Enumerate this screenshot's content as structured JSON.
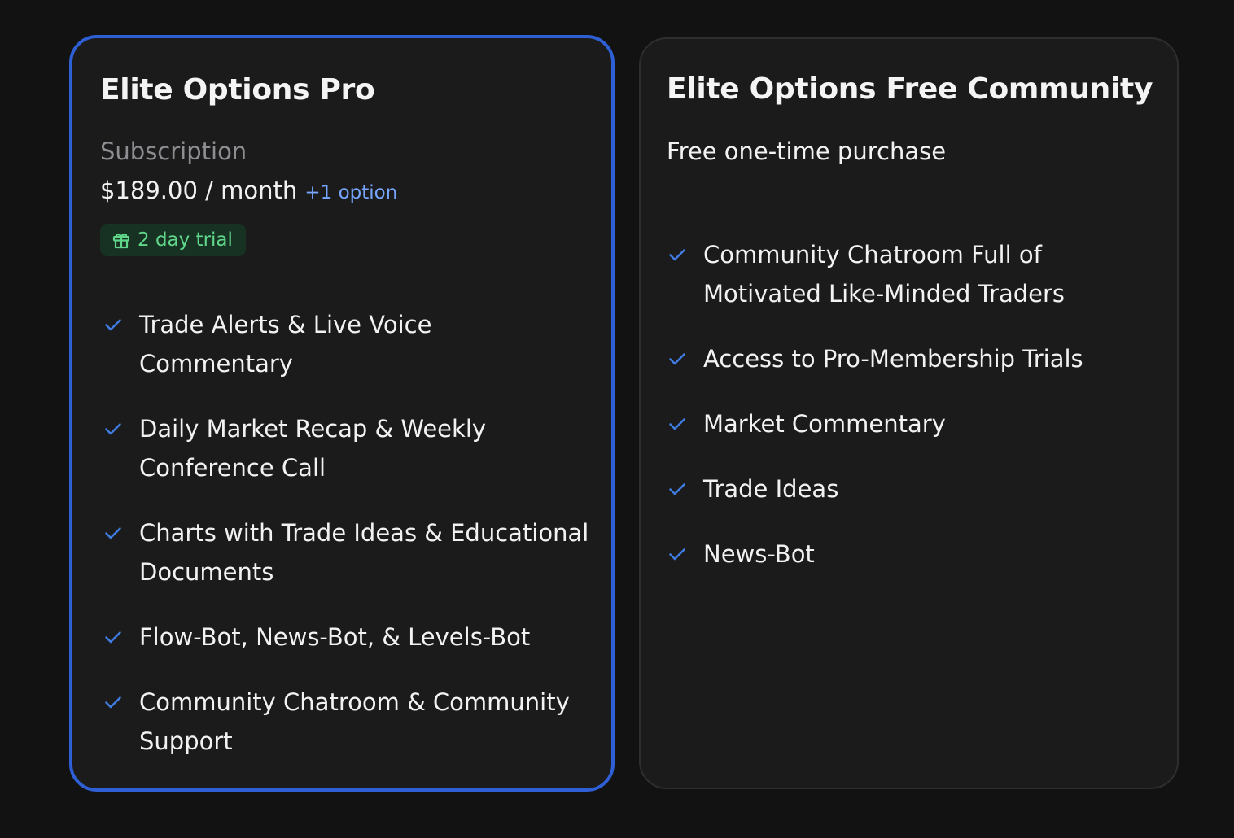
{
  "colors": {
    "background": "#121212",
    "card": "#1b1b1c",
    "selected_border": "#2f5fd4",
    "check": "#3f7be0",
    "link": "#77a6ff",
    "badge_bg": "#173222",
    "badge_text": "#5fd68a"
  },
  "plans": {
    "pro": {
      "title": "Elite Options Pro",
      "billing_label": "Subscription",
      "price": "$189.00 / month",
      "more_options": "+1 option",
      "trial": {
        "icon": "gift-icon",
        "label": "2 day trial"
      },
      "features": [
        "Trade Alerts & Live Voice Commentary",
        "Daily Market Recap & Weekly Conference Call",
        "Charts with Trade Ideas & Educational Documents",
        "Flow-Bot, News-Bot, & Levels-Bot",
        "Community Chatroom & Community Support"
      ]
    },
    "free": {
      "title": "Elite Options Free Community",
      "description": "Free one-time purchase",
      "features": [
        "Community Chatroom Full of Motivated Like-Minded Traders",
        "Access to Pro-Membership Trials",
        "Market Commentary",
        "Trade Ideas",
        "News-Bot"
      ]
    }
  }
}
